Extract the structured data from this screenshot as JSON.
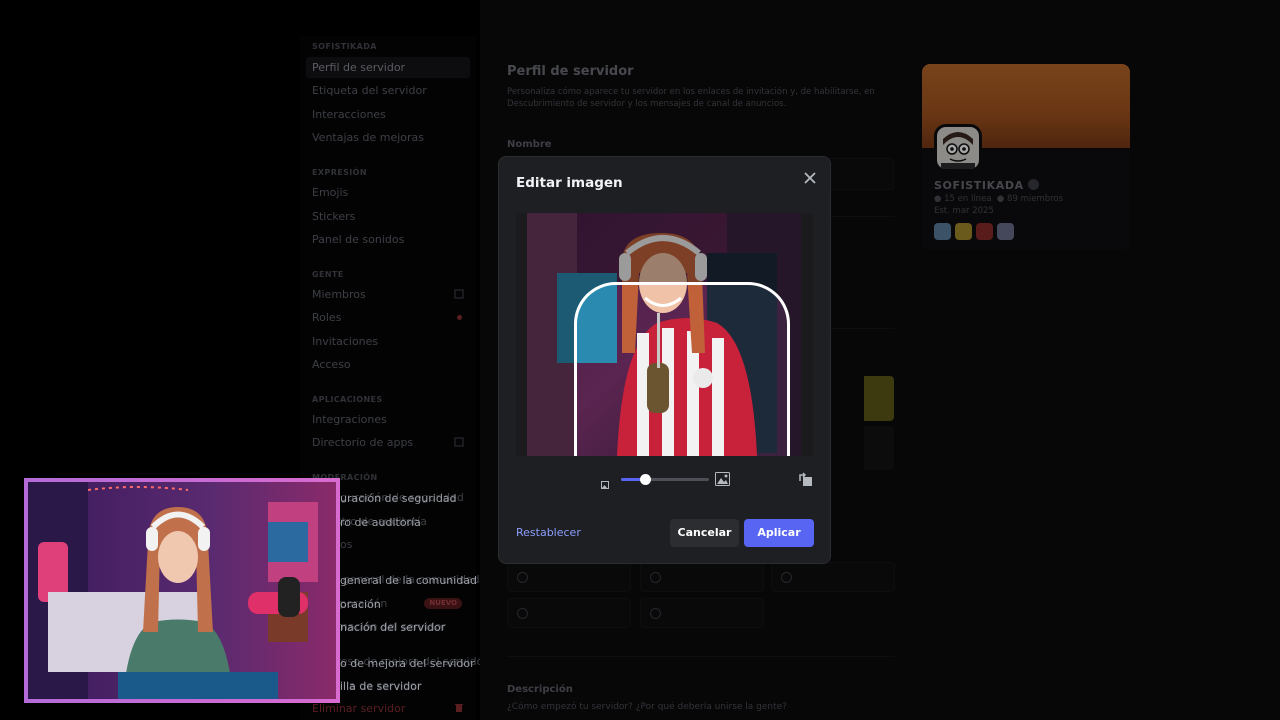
{
  "window": {
    "controls": "—"
  },
  "sidebar": {
    "sections": [
      {
        "title": "SOFISTIKADA",
        "items": [
          {
            "label": "Perfil de servidor",
            "active": true
          },
          {
            "label": "Etiqueta del servidor"
          },
          {
            "label": "Interacciones"
          },
          {
            "label": "Ventajas de mejoras"
          }
        ]
      },
      {
        "title": "EXPRESIÓN",
        "items": [
          {
            "label": "Emojis"
          },
          {
            "label": "Stickers"
          },
          {
            "label": "Panel de sonidos"
          }
        ]
      },
      {
        "title": "GENTE",
        "items": [
          {
            "label": "Miembros"
          },
          {
            "label": "Roles"
          },
          {
            "label": "Invitaciones"
          },
          {
            "label": "Acceso"
          }
        ]
      },
      {
        "title": "APLICACIONES",
        "items": [
          {
            "label": "Integraciones"
          },
          {
            "label": "Directorio de apps"
          }
        ]
      },
      {
        "title": "MODERACIÓN",
        "items": [
          {
            "label": "Configuración de seguridad"
          },
          {
            "label": "Registro de auditoría"
          },
          {
            "label": "Baneos"
          }
        ]
      },
      {
        "title": "",
        "items": [
          {
            "label": "Vista general de la comunidad"
          },
          {
            "label": "Incorporación",
            "badge": "NUEVO"
          },
          {
            "label": "Información del servidor"
          },
          {
            "label": "Progreso de mejora del servidor"
          },
          {
            "label": "Plantilla de servidor"
          },
          {
            "label": "Eliminar servidor"
          }
        ]
      }
    ],
    "visible": {
      "s0": "SOFISTIKADA",
      "i0": "Perfil de servidor",
      "i1": "Etiqueta del servidor",
      "i2": "Interacciones",
      "i3": "Ventajas de mejoras",
      "s1": "EXPRESIÓN",
      "i4": "Emojis",
      "i5": "Stickers",
      "i6": "Panel de sonidos",
      "s2": "GENTE",
      "i7": "Miembros",
      "i8": "Roles",
      "i9": "Invitaciones",
      "i10": "Acceso",
      "s3": "APLICACIONES",
      "i11": "Integraciones",
      "i12": "Directorio de apps",
      "s4": "MODERACIÓN",
      "i13": "Configuración de seguridad",
      "i14": "Registro de auditoría",
      "i15": "Baneos",
      "i16": "Vista general de la comunidad",
      "i17": "Incorporación",
      "badge": "NUEVO",
      "i18": "Información del servidor",
      "i19": "Progreso de mejora del servidor",
      "i20": "Plantilla de servidor",
      "i21": "Eliminar servidor"
    }
  },
  "main": {
    "title": "Perfil de servidor",
    "description": "Personaliza cómo aparece tu servidor en los enlaces de invitación y, de habilitarse, en Descubrimiento de servidor y los mensajes de canal de anuncios.",
    "name_label": "Nombre",
    "description_label": "Descripción",
    "description_placeholder": "¿Cómo empezó tu servidor? ¿Por qué debería unirse la gente?"
  },
  "preview": {
    "server_name": "SOFISTIKADA",
    "online": "15 en línea",
    "members": "89 miembros",
    "established": "Est. mar 2025"
  },
  "modal": {
    "title": "Editar imagen",
    "reset_label": "Restablecer",
    "cancel_label": "Cancelar",
    "apply_label": "Aplicar",
    "zoom_level": 0.27
  },
  "webcam_overlay": {
    "t1": "uración de seguridad",
    "t2": "ro de auditoría",
    "t3": "general de la comunidad",
    "t4": "oración",
    "t5": "nación del servidor",
    "t6": "o de mejora del servidor",
    "t7": "illa de servidor",
    "t8": "Eliminar servidor"
  },
  "colors": {
    "accent": "#5865f2",
    "link": "#8c9eff",
    "danger": "#8b2f33"
  },
  "icons": [
    "close-icon",
    "image-small-icon",
    "image-large-icon",
    "rotate-icon",
    "external-link-icon",
    "verified-icon"
  ]
}
